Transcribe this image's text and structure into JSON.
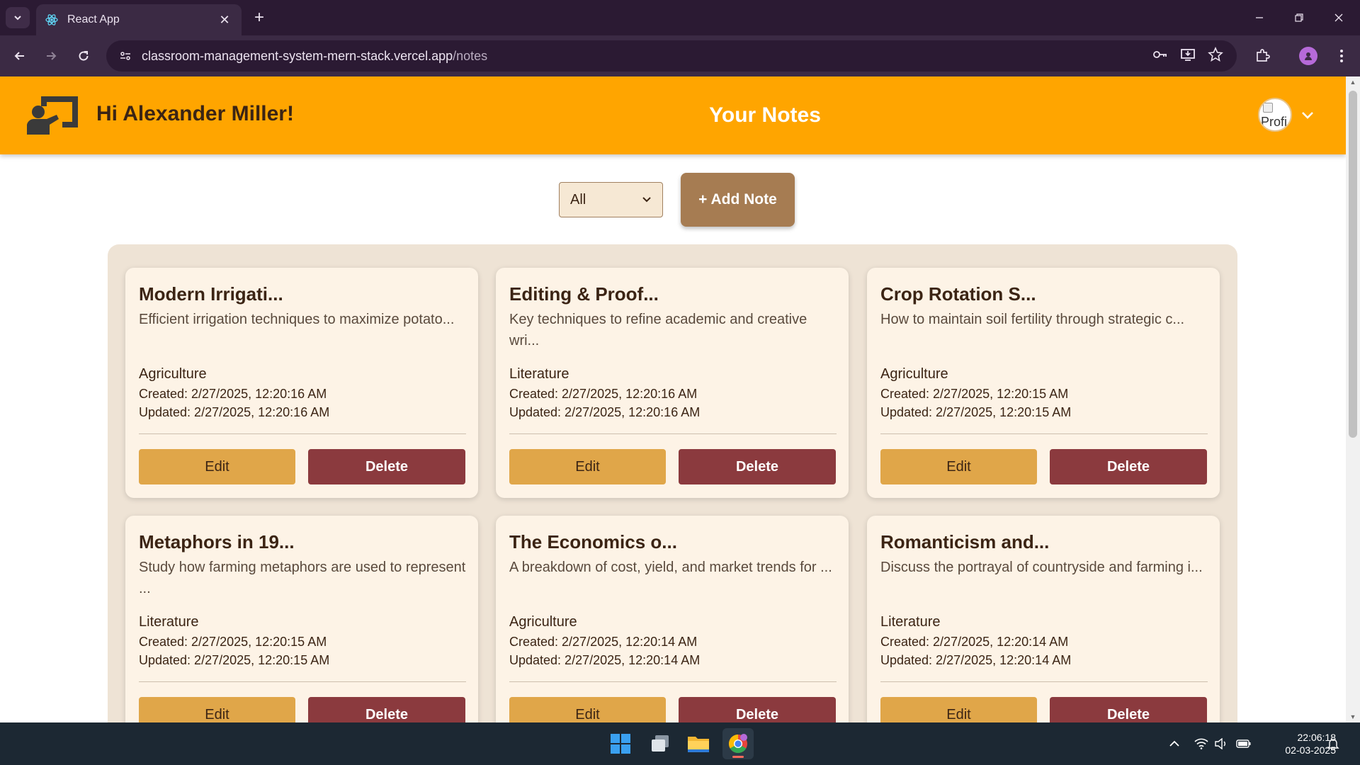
{
  "browser": {
    "tab_title": "React App",
    "url_domain": "classroom-management-system-mern-stack.vercel.app",
    "url_path": "/notes"
  },
  "header": {
    "greeting": "Hi Alexander Miller!",
    "title": "Your Notes",
    "avatar_alt": "Profi",
    "color": "#ffa500"
  },
  "controls": {
    "filter_value": "All",
    "add_note_label": "+ Add Note"
  },
  "notes": [
    {
      "title": "Modern Irrigati...",
      "description": "Efficient irrigation techniques to maximize potato...",
      "category": "Agriculture",
      "created": "Created: 2/27/2025, 12:20:16 AM",
      "updated": "Updated: 2/27/2025, 12:20:16 AM",
      "edit_label": "Edit",
      "delete_label": "Delete"
    },
    {
      "title": "Editing & Proof...",
      "description": "Key techniques to refine academic and creative wri...",
      "category": "Literature",
      "created": "Created: 2/27/2025, 12:20:16 AM",
      "updated": "Updated: 2/27/2025, 12:20:16 AM",
      "edit_label": "Edit",
      "delete_label": "Delete"
    },
    {
      "title": "Crop Rotation S...",
      "description": "How to maintain soil fertility through strategic c...",
      "category": "Agriculture",
      "created": "Created: 2/27/2025, 12:20:15 AM",
      "updated": "Updated: 2/27/2025, 12:20:15 AM",
      "edit_label": "Edit",
      "delete_label": "Delete"
    },
    {
      "title": "Metaphors in 19...",
      "description": "Study how farming metaphors are used to represent ...",
      "category": "Literature",
      "created": "Created: 2/27/2025, 12:20:15 AM",
      "updated": "Updated: 2/27/2025, 12:20:15 AM",
      "edit_label": "Edit",
      "delete_label": "Delete"
    },
    {
      "title": "The Economics o...",
      "description": "A breakdown of cost, yield, and market trends for ...",
      "category": "Agriculture",
      "created": "Created: 2/27/2025, 12:20:14 AM",
      "updated": "Updated: 2/27/2025, 12:20:14 AM",
      "edit_label": "Edit",
      "delete_label": "Delete"
    },
    {
      "title": "Romanticism and...",
      "description": "Discuss the portrayal of countryside and farming i...",
      "category": "Literature",
      "created": "Created: 2/27/2025, 12:20:14 AM",
      "updated": "Updated: 2/27/2025, 12:20:14 AM",
      "edit_label": "Edit",
      "delete_label": "Delete"
    }
  ],
  "taskbar": {
    "time": "22:06:18",
    "date": "02-03-2025"
  }
}
